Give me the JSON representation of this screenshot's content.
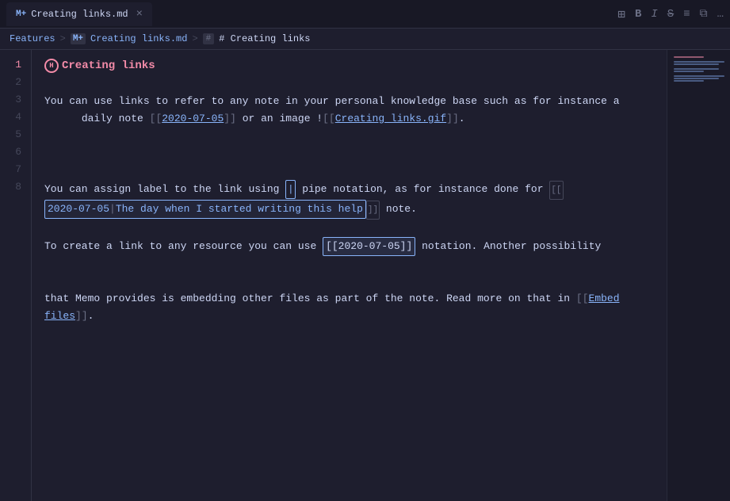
{
  "titlebar": {
    "tab_icon": "M+",
    "tab_label": "Creating links.md",
    "tab_close": "×",
    "icons": {
      "columns": "⊞",
      "bold": "B",
      "italic": "I",
      "strikethrough": "S",
      "list": "≡",
      "split": "⧉",
      "more": "…"
    }
  },
  "breadcrumb": {
    "features": "Features",
    "sep1": ">",
    "md_icon": "M+",
    "file": "Creating links.md",
    "sep2": ">",
    "hash_icon": "#",
    "heading": "# Creating links"
  },
  "lines": {
    "numbers": [
      1,
      2,
      3,
      4,
      5,
      6,
      7,
      8
    ],
    "active_line": 1
  },
  "content": {
    "heading": "Creating links",
    "line3_part1": "You can use links to refer to any note in your personal knowledge base such as for instance a",
    "line3_part2": "daily note ",
    "line3_link1": "2020-07-05",
    "line3_part3": " or an image !",
    "line3_link2": "Creating links.gif",
    "line3_end": ".",
    "line5_part1": "You can assign label to the link using ",
    "line5_pipe": "|",
    "line5_part2": " pipe notation, as for instance done for ",
    "line5_wikidate": "2020-07-05",
    "line5_wisep": "|",
    "line5_wikilabel": "The day when I started writing this help",
    "line5_part3": " note.",
    "line7_part1": "To create a link to any resource you can use ",
    "line7_inline": "[[2020-07-05]]",
    "line7_part2": " notation. Another possibility",
    "line7_part3": "that Memo provides is embedding other files as part of the note. Read more on that in ",
    "line7_embed": "Embed",
    "line7_part4": "files",
    "line7_end": "."
  }
}
